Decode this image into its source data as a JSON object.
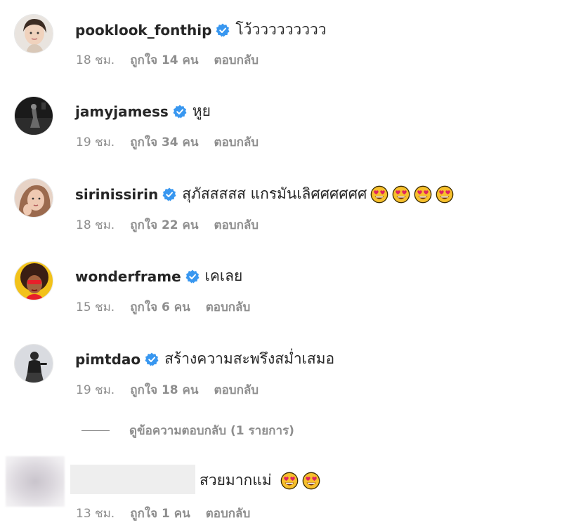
{
  "comments": [
    {
      "username": "pooklook_fonthip",
      "text": "โว้ววววววววว",
      "time": "18 ชม.",
      "likes": "ถูกใจ 14 คน",
      "reply": "ตอบกลับ",
      "emoji_count": 0,
      "avatar_icon": "woman-portrait-icon"
    },
    {
      "username": "jamyjamess",
      "text": "หูย",
      "time": "19 ชม.",
      "likes": "ถูกใจ 34 คน",
      "reply": "ตอบกลับ",
      "emoji_count": 0,
      "avatar_icon": "dark-photo-icon"
    },
    {
      "username": "sirinissirin",
      "text": "สุภัสสสสส แกรมันเลิศศศศศศ",
      "time": "18 ชม.",
      "likes": "ถูกใจ 22 คน",
      "reply": "ตอบกลับ",
      "emoji_count": 4,
      "avatar_icon": "woman-portrait-icon"
    },
    {
      "username": "wonderframe",
      "text": "เคเลย",
      "time": "15 ชม.",
      "likes": "ถูกใจ 6 คน",
      "reply": "ตอบกลับ",
      "emoji_count": 0,
      "avatar_icon": "afro-woman-portrait-icon"
    },
    {
      "username": "pimtdao",
      "text": "สร้างความสะพรึงสม่ำเสมอ",
      "time": "19 ชม.",
      "likes": "ถูกใจ 18 คน",
      "reply": "ตอบกลับ",
      "emoji_count": 0,
      "avatar_icon": "woman-standing-icon"
    }
  ],
  "view_replies": "ดูข้อความตอบกลับ (1 รายการ)",
  "last_comment": {
    "text": "สวยมากแม่",
    "time": "13 ชม.",
    "likes": "ถูกใจ 1 คน",
    "reply": "ตอบกลับ",
    "emoji_count": 2
  },
  "colors": {
    "verified": "#3897f0",
    "meta": "#8e8e8e",
    "text": "#262626"
  },
  "emoji_name": "heart-eyes-emoji-icon"
}
